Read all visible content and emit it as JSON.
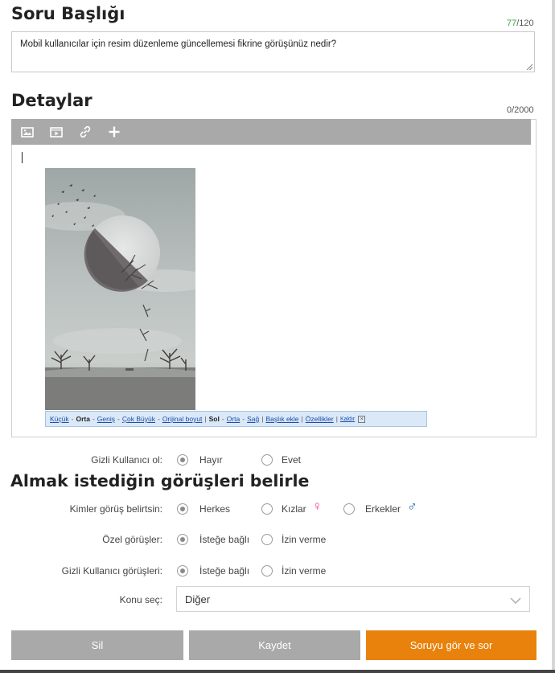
{
  "question": {
    "heading": "Soru Başlığı",
    "counter_used": "77",
    "counter_max": "/120",
    "value": "Mobil kullanıcılar için resim düzenleme güncellemesi fikrine görüşünüz nedir?"
  },
  "details": {
    "heading": "Detaylar",
    "counter": "0/2000",
    "toolbar": [
      "image-icon",
      "video-icon",
      "link-icon",
      "plus-icon"
    ],
    "image_bar": {
      "sizes": [
        "Küçük",
        "Orta",
        "Geniş",
        "Çok Büyük",
        "Orijinal boyut"
      ],
      "active_size": "Orta",
      "aligns": [
        "Sol",
        "Orta",
        "Sağ"
      ],
      "active_align": "Sol",
      "caption": "Başlık ekle",
      "properties": "Özellikler",
      "remove": "Kaldır",
      "close": "×"
    }
  },
  "anonymous": {
    "label": "Gizli Kullanıcı ol:",
    "options": [
      "Hayır",
      "Evet"
    ],
    "selected": "Hayır"
  },
  "opinions": {
    "heading": "Almak istediğin görüşleri belirle",
    "who": {
      "label": "Kimler görüş belirtsin:",
      "options": [
        "Herkes",
        "Kızlar",
        "Erkekler"
      ],
      "selected": "Herkes",
      "female_symbol": "♀",
      "male_symbol": "♂",
      "female_color": "#e8479a",
      "male_color": "#1f5fb0"
    },
    "private": {
      "label": "Özel görüşler:",
      "options": [
        "İsteğe bağlı",
        "İzin verme"
      ],
      "selected": "İsteğe bağlı"
    },
    "anon_opinions": {
      "label": "Gizli Kullanıcı görüşleri:",
      "options": [
        "İsteğe bağlı",
        "İzin verme"
      ],
      "selected": "İsteğe bağlı"
    },
    "topic": {
      "label": "Konu seç:",
      "value": "Diğer"
    }
  },
  "actions": {
    "delete": "Sil",
    "save": "Kaydet",
    "preview": "Soruyu gör ve sor"
  },
  "colors": {
    "accent": "#e8820c",
    "counter_ok": "#3aa84a",
    "toolbar_bg": "#a9a9a9",
    "button_gray": "#a9a9a9"
  }
}
